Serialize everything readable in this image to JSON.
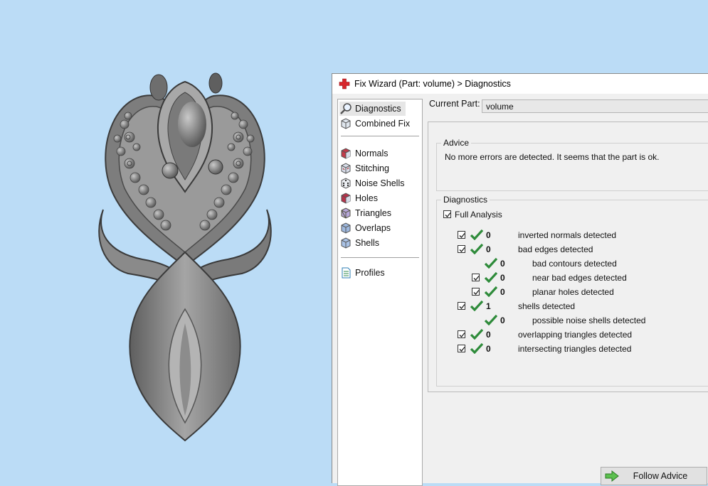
{
  "dialog": {
    "title": "Fix Wizard (Part: volume) > Diagnostics",
    "current_part_label": "Current Part:",
    "current_part_value": "volume"
  },
  "nav": {
    "items": [
      {
        "label": "Diagnostics",
        "icon": "magnifier-icon"
      },
      {
        "label": "Combined Fix",
        "icon": "cube-icon"
      },
      {
        "label": "Normals",
        "icon": "cube-red-icon"
      },
      {
        "label": "Stitching",
        "icon": "stitch-cube-icon"
      },
      {
        "label": "Noise Shells",
        "icon": "dice-icon"
      },
      {
        "label": "Holes",
        "icon": "cube-red-icon"
      },
      {
        "label": "Triangles",
        "icon": "purple-cube-icon"
      },
      {
        "label": "Overlaps",
        "icon": "blue-cube-icon"
      },
      {
        "label": "Shells",
        "icon": "blue-cube-icon"
      },
      {
        "label": "Profiles",
        "icon": "document-icon"
      }
    ]
  },
  "advice": {
    "title": "Advice",
    "text": "No more errors are detected. It seems that the part is ok."
  },
  "diagnostics": {
    "title": "Diagnostics",
    "full_analysis": "Full Analysis",
    "rows": [
      {
        "count": "0",
        "label": "inverted normals detected",
        "checked": true
      },
      {
        "count": "0",
        "label": "bad edges detected",
        "checked": true
      },
      {
        "count": "0",
        "label": "bad contours detected",
        "checked": false
      },
      {
        "count": "0",
        "label": "near bad edges detected",
        "checked": true
      },
      {
        "count": "0",
        "label": "planar holes detected",
        "checked": true
      },
      {
        "count": "1",
        "label": "shells detected",
        "checked": true
      },
      {
        "count": "0",
        "label": "possible noise shells detected",
        "checked": false
      },
      {
        "count": "0",
        "label": "overlapping triangles detected",
        "checked": true
      },
      {
        "count": "0",
        "label": "intersecting triangles detected",
        "checked": true
      }
    ]
  },
  "buttons": {
    "follow_advice": "Follow Advice"
  },
  "colors": {
    "viewport_bg": "#bbdcf6",
    "model_gray": "#8f8f8f",
    "check_green": "#2e8b3a"
  }
}
